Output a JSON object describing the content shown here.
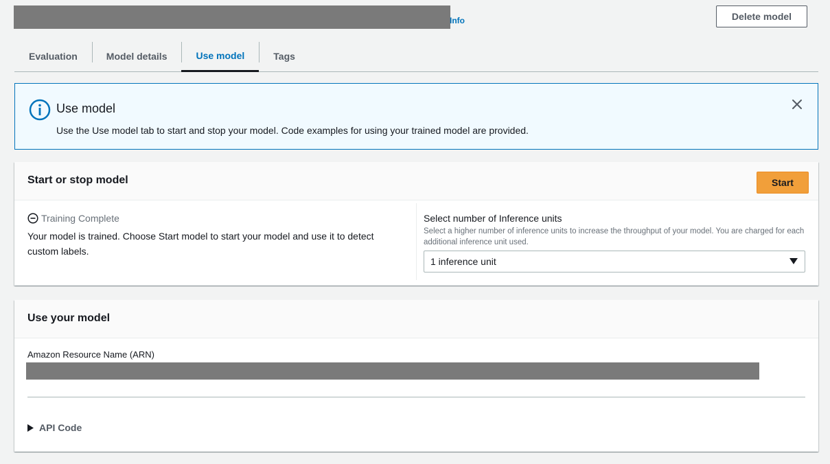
{
  "header": {
    "info_link": "Info",
    "delete_button": "Delete model"
  },
  "tabs": [
    {
      "label": "Evaluation",
      "active": false
    },
    {
      "label": "Model details",
      "active": false
    },
    {
      "label": "Use model",
      "active": true
    },
    {
      "label": "Tags",
      "active": false
    }
  ],
  "flash": {
    "icon": "info-icon",
    "title": "Use model",
    "body": "Use the Use model tab to start and stop your model. Code examples for using your trained model are provided."
  },
  "start_stop": {
    "title": "Start or stop model",
    "start_button": "Start",
    "status": "Training Complete",
    "status_description": "Your model is trained. Choose Start model to start your model and use it to detect custom labels.",
    "inference_label": "Select number of Inference units",
    "inference_description": "Select a higher number of inference units to increase the throughput of your model. You are charged for each additional inference unit used.",
    "inference_selected": "1 inference unit"
  },
  "use_model": {
    "title": "Use your model",
    "arn_label": "Amazon Resource Name (ARN)",
    "api_code_label": "API Code"
  },
  "colors": {
    "accent": "#0073bb",
    "primary_button": "#f19f3a",
    "flash_bg": "#f1faff",
    "redacted": "#7a7a7a"
  }
}
